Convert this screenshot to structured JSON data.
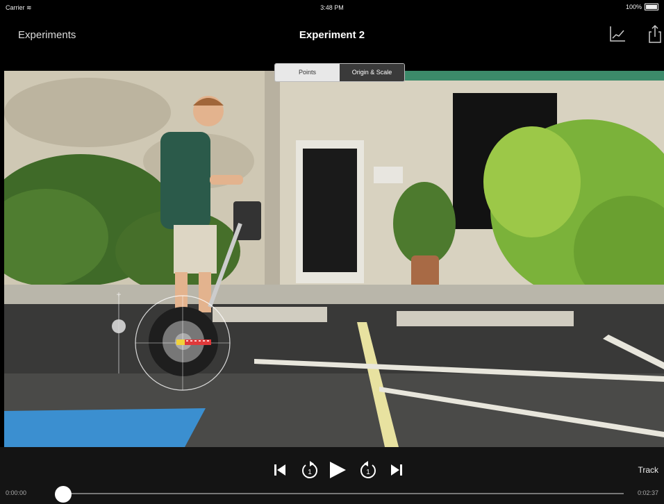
{
  "status": {
    "carrier": "Carrier",
    "time": "3:48 PM",
    "battery": "100%"
  },
  "nav": {
    "back_label": "Experiments",
    "title": "Experiment 2",
    "graph_icon": "graph-icon",
    "share_icon": "share-icon"
  },
  "segmented": {
    "options": [
      "Points",
      "Origin & Scale"
    ],
    "selected": "Origin & Scale"
  },
  "video_overlay": {
    "icons": [
      "origin-scale-handle-icon",
      "rotation-circle-icon",
      "vertical-slider-icon"
    ]
  },
  "controls": {
    "icons": [
      "skip-to-start-icon",
      "step-back-icon",
      "play-icon",
      "step-forward-icon",
      "skip-to-end-icon"
    ],
    "track_label": "Track",
    "time_start": "0:00:00",
    "time_end": "0:02:37",
    "playback_position": 0
  },
  "colors": {
    "bar": "#141414",
    "accent": "#ffffff",
    "scale_marker": "#e0393a",
    "scale_marker_alt": "#f1d23b"
  }
}
